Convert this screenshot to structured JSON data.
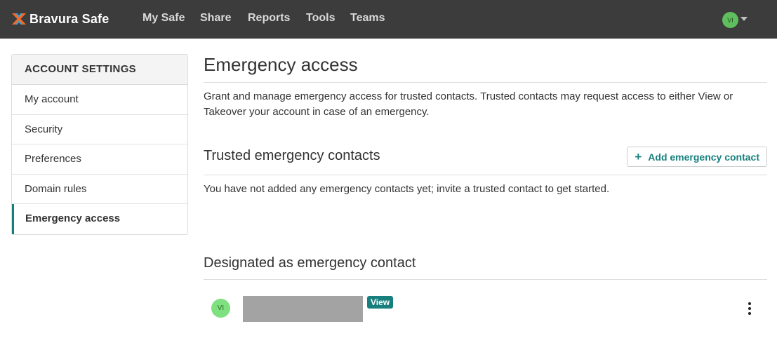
{
  "navbar": {
    "brand": "Bravura Safe",
    "links": [
      "My Safe",
      "Share",
      "Reports",
      "Tools",
      "Teams"
    ],
    "avatar_initials": "VI"
  },
  "sidebar": {
    "header": "ACCOUNT SETTINGS",
    "items": [
      {
        "label": "My account"
      },
      {
        "label": "Security"
      },
      {
        "label": "Preferences"
      },
      {
        "label": "Domain rules"
      },
      {
        "label": "Emergency access",
        "active": true
      }
    ]
  },
  "main": {
    "title": "Emergency access",
    "description": "Grant and manage emergency access for trusted contacts. Trusted contacts may request access to either View or Takeover your account in case of an emergency.",
    "trusted": {
      "title": "Trusted emergency contacts",
      "add_button_label": "Add emergency contact",
      "add_button_icon": "plus-icon",
      "empty_text": "You have not added any emergency contacts yet; invite a trusted contact to get started."
    },
    "designated": {
      "title": "Designated as emergency contact",
      "contacts": [
        {
          "avatar_initials": "VI",
          "access_badge": "View"
        }
      ]
    }
  },
  "colors": {
    "navbar_bg": "#3c3c3c",
    "accent": "#17807e",
    "avatar_green": "#7ee07e"
  }
}
